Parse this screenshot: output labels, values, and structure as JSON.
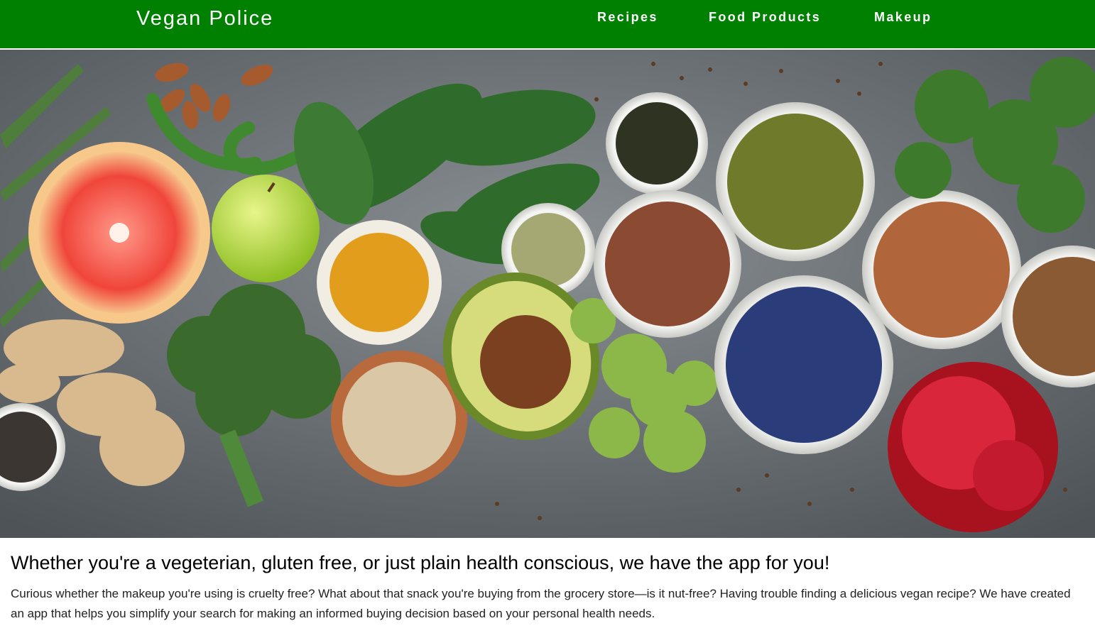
{
  "header": {
    "brand": "Vegan Police",
    "background_color": "#008000",
    "text_color": "#ffffff",
    "nav": [
      {
        "label": "Recipes"
      },
      {
        "label": "Food Products"
      },
      {
        "label": "Makeup"
      }
    ]
  },
  "hero": {
    "image_subject": "flat-lay-healthy-vegan-foods"
  },
  "main": {
    "headline": "Whether you're a vegeterian, gluten free, or just plain health conscious, we have the app for you!",
    "description": "Curious whether the makeup you're using is cruelty free? What about that snack you're buying from the grocery store—is it nut-free? Having trouble finding a delicious vegan recipe? We have created an app that helps you simplify your search for making an informed buying decision based on your personal health needs."
  }
}
